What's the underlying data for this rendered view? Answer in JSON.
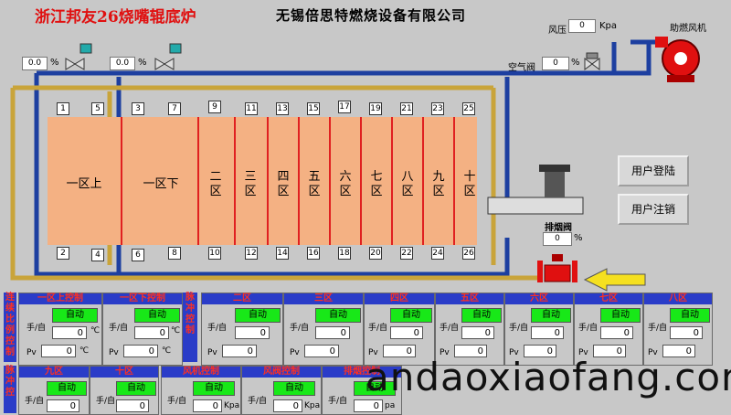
{
  "header": {
    "title": "浙江邦友26烧嘴辊底炉",
    "company": "无锡倍思特燃烧设备有限公司"
  },
  "top": {
    "pressure_label": "风压",
    "pressure_value": "0",
    "pressure_unit": "Kpa",
    "fan_label": "助燃风机",
    "air_valve_label": "空气阀",
    "air_valve_value": "0",
    "pct": "%",
    "valve1_value": "0.0",
    "valve2_value": "0.0"
  },
  "exhaust": {
    "label": "排烟阀",
    "value": "0",
    "unit": "%"
  },
  "zones": [
    {
      "label": "一区上"
    },
    {
      "label": "一区下"
    },
    {
      "label": "二\n区"
    },
    {
      "label": "三\n区"
    },
    {
      "label": "四\n区"
    },
    {
      "label": "五\n区"
    },
    {
      "label": "六\n区"
    },
    {
      "label": "七\n区"
    },
    {
      "label": "八\n区"
    },
    {
      "label": "九\n区"
    },
    {
      "label": "十\n区"
    }
  ],
  "burners_top": [
    "1",
    "5",
    "3",
    "7",
    "9",
    "11",
    "13",
    "15",
    "17",
    "19",
    "21",
    "23",
    "25"
  ],
  "burners_bottom": [
    "2",
    "4",
    "6",
    "8",
    "10",
    "12",
    "14",
    "16",
    "18",
    "20",
    "22",
    "24",
    "26"
  ],
  "buttons": {
    "login": "用户登陆",
    "logout": "用户注销"
  },
  "panels_row1": [
    {
      "title": "一区上控制"
    },
    {
      "title": "一区下控制"
    },
    {
      "title": "二区"
    },
    {
      "title": "三区"
    },
    {
      "title": "四区"
    },
    {
      "title": "五区"
    },
    {
      "title": "六区"
    },
    {
      "title": "七区"
    },
    {
      "title": "八区"
    }
  ],
  "panels_row2": [
    {
      "title": "九区"
    },
    {
      "title": "十区"
    },
    {
      "title": "风机控制",
      "unit": "Kpa"
    },
    {
      "title": "风阀控制",
      "unit": "Kpa"
    },
    {
      "title": "排烟控制",
      "unit": "pa"
    }
  ],
  "panel_common": {
    "mode": "手/自",
    "auto": "自动",
    "value": "0",
    "unit": "℃",
    "pv": "Pv",
    "pv_value": "0"
  },
  "side_labels": {
    "left1": "连续比例控制",
    "left2": "脉冲控",
    "mid": "脉冲控制"
  },
  "watermark": "andaoxiaofang.com",
  "colors": {
    "zone": "#f4b183",
    "pipe_gold": "#c9a43a",
    "pipe_blue": "#1d3fa0",
    "auto_green": "#18e818",
    "panel_header": "#2a3cc8"
  }
}
